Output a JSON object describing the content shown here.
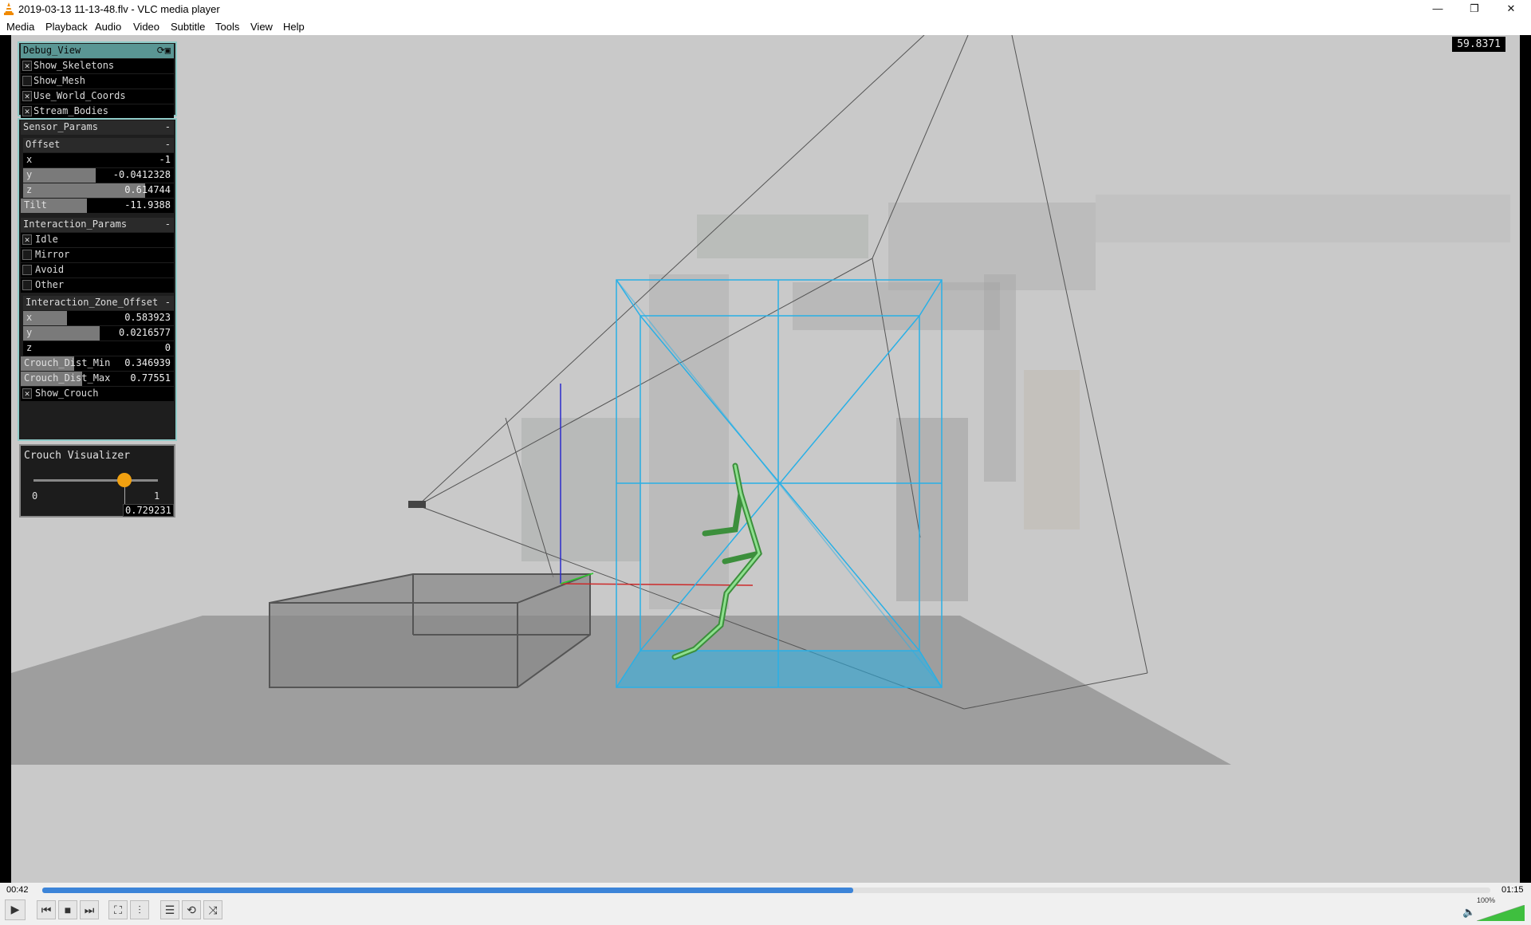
{
  "window": {
    "title": "2019-03-13 11-13-48.flv - VLC media player",
    "minimize_glyph": "—",
    "maximize_glyph": "❐",
    "close_glyph": "✕"
  },
  "menu": [
    "Media",
    "Playback",
    "Audio",
    "Video",
    "Subtitle",
    "Tools",
    "View",
    "Help"
  ],
  "overlay": {
    "fps": "59.8371"
  },
  "debug_view": {
    "title": "Debug_View",
    "toggles": [
      {
        "label": "Show_Skeletons",
        "checked": true
      },
      {
        "label": "Show_Mesh",
        "checked": false
      },
      {
        "label": "Use_World_Coords",
        "checked": true
      },
      {
        "label": "Stream_Bodies",
        "checked": true
      }
    ]
  },
  "sensor_params": {
    "title": "Sensor_Params",
    "collapse": "-",
    "offset": {
      "title": "Offset",
      "collapse": "-",
      "x": {
        "label": "x",
        "value": "-1",
        "fill": 0.0
      },
      "y": {
        "label": "y",
        "value": "-0.0412328",
        "fill": 0.48
      },
      "z": {
        "label": "z",
        "value": "0.614744",
        "fill": 0.81
      }
    },
    "tilt": {
      "label": "Tilt",
      "value": "-11.9388",
      "fill": 0.43
    }
  },
  "interaction_params": {
    "title": "Interaction_Params",
    "collapse": "-",
    "modes": [
      {
        "label": "Idle",
        "checked": true
      },
      {
        "label": "Mirror",
        "checked": false
      },
      {
        "label": "Avoid",
        "checked": false
      },
      {
        "label": "Other",
        "checked": false
      }
    ],
    "zone_offset": {
      "title": "Interaction_Zone_Offset",
      "collapse": "-",
      "x": {
        "label": "x",
        "value": "0.583923",
        "fill": 0.29
      },
      "y": {
        "label": "y",
        "value": "0.0216577",
        "fill": 0.51
      },
      "z": {
        "label": "z",
        "value": "0",
        "fill": 0.0
      }
    },
    "crouch_min": {
      "label": "Crouch_Dist_Min",
      "value": "0.346939",
      "fill": 0.35
    },
    "crouch_max": {
      "label": "Crouch_Dist_Max",
      "value": "0.77551",
      "fill": 0.4
    },
    "show_crouch": {
      "label": "Show_Crouch",
      "checked": true
    }
  },
  "crouch_visualizer": {
    "title": "Crouch Visualizer",
    "min_label": "0",
    "max_label": "1",
    "value": "0.729231",
    "level": 0.729
  },
  "playback": {
    "elapsed": "00:42",
    "total": "01:15",
    "progress": 0.56,
    "volume": "100%",
    "volume_level": 1.0
  },
  "icons": {
    "play": "play-icon",
    "prev": "previous-icon",
    "stop": "stop-icon",
    "next": "next-icon",
    "fullscreen": "fullscreen-icon",
    "extended": "extended-settings-icon",
    "playlist": "playlist-icon",
    "loop": "loop-icon",
    "shuffle": "shuffle-icon",
    "speaker": "speaker-icon"
  },
  "colors": {
    "progress": "#3c84d8",
    "zone_box": "#29b0e6",
    "skeleton": "#55c455",
    "crouch_handle": "#f0a010"
  }
}
